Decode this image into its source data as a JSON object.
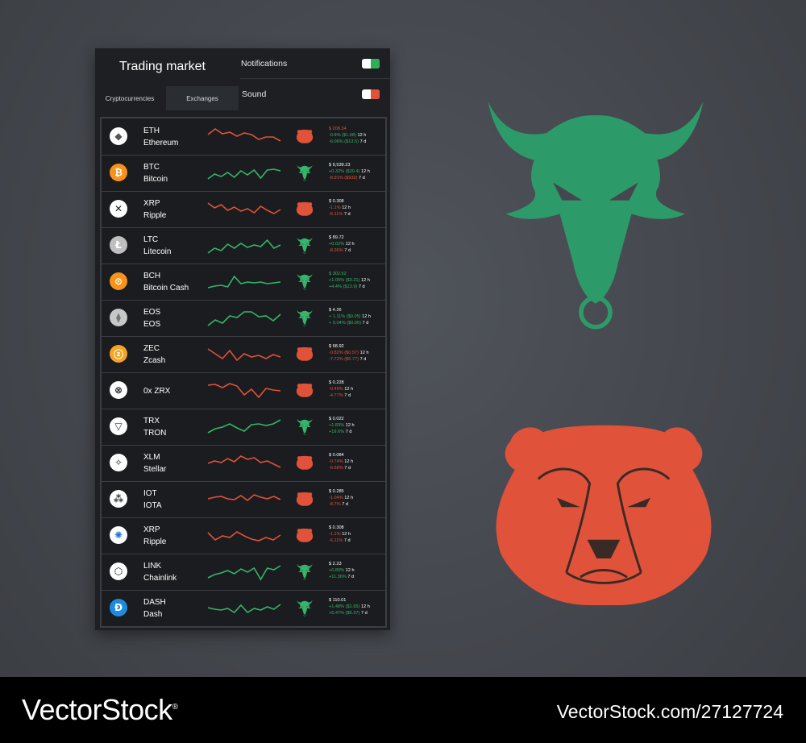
{
  "header": {
    "title": "Trading market"
  },
  "tabs": [
    {
      "label": "Cryptocurrencies"
    },
    {
      "label": "Exchanges"
    }
  ],
  "settings": {
    "notifications": {
      "label": "Notifications",
      "state": "on",
      "color": "#2fae58"
    },
    "sound": {
      "label": "Sound",
      "state": "off",
      "color": "#e0523a"
    }
  },
  "colors": {
    "up": "#35b56a",
    "down": "#e0523a",
    "bull_logo": "#2c9b69",
    "bear_logo": "#e0523a"
  },
  "coins": [
    {
      "symbol": "ETH",
      "name": "Ethereum",
      "icon": "ethereum-icon",
      "glyph": "◆",
      "icon_bg": "#ffffff",
      "icon_fg": "#555555",
      "trend": "down",
      "price": "$ 208.34",
      "price_trend": "down",
      "line1": {
        "text": "-0.8% ($1.68)",
        "period": "12 h",
        "trend": "up"
      },
      "line2": {
        "text": "-6.06% ($13.5)",
        "period": "7 d",
        "trend": "up"
      },
      "spark": [
        10,
        3,
        9,
        7,
        12,
        8,
        10,
        16,
        13,
        13,
        18
      ]
    },
    {
      "symbol": "BTC",
      "name": "Bitcoin",
      "icon": "bitcoin-icon",
      "glyph": "₿",
      "icon_bg": "#f7931a",
      "icon_fg": "#ffffff",
      "trend": "up",
      "price": "$ 9,539.23",
      "price_trend": "neutral",
      "line1": {
        "text": "+0.32% ($30.4)",
        "period": "12 h",
        "trend": "up"
      },
      "line2": {
        "text": "-8.91% ($933)",
        "period": "7 d",
        "trend": "down"
      },
      "spark": [
        20,
        14,
        17,
        12,
        18,
        10,
        15,
        9,
        19,
        9,
        8,
        10
      ]
    },
    {
      "symbol": "XRP",
      "name": "Ripple",
      "icon": "xrp-icon",
      "glyph": "✕",
      "icon_bg": "#ffffff",
      "icon_fg": "#222222",
      "trend": "down",
      "price": "$ 0.308",
      "price_trend": "neutral",
      "line1": {
        "text": "-1.1%",
        "period": "12 h",
        "trend": "down"
      },
      "line2": {
        "text": "-6.11%",
        "period": "7 d",
        "trend": "down"
      },
      "spark": [
        5,
        11,
        7,
        14,
        10,
        15,
        12,
        17,
        9,
        14,
        18,
        13
      ]
    },
    {
      "symbol": "LTC",
      "name": "Litecoin",
      "icon": "litecoin-icon",
      "glyph": "Ł",
      "icon_bg": "#bfbfbf",
      "icon_fg": "#ffffff",
      "trend": "up",
      "price": "$ 89.72",
      "price_trend": "neutral",
      "line1": {
        "text": "+0.02%",
        "period": "12 h",
        "trend": "up"
      },
      "line2": {
        "text": "-8.36%",
        "period": "7 d",
        "trend": "down"
      },
      "spark": [
        22,
        16,
        19,
        11,
        16,
        10,
        15,
        12,
        14,
        6,
        16,
        12
      ]
    },
    {
      "symbol": "BCH",
      "name": "Bitcoin Cash",
      "icon": "bitcoin-cash-icon",
      "glyph": "⊙",
      "icon_bg": "#f7931a",
      "icon_fg": "#ffffff",
      "trend": "up",
      "price": "$ 302.52",
      "price_trend": "up",
      "line1": {
        "text": "+1.05% ($3.21)",
        "period": "12 h",
        "trend": "up"
      },
      "line2": {
        "text": "+4.4% ($13.9)",
        "period": "7 d",
        "trend": "up"
      },
      "spark": [
        20,
        18,
        17,
        19,
        6,
        15,
        13,
        14,
        13,
        15,
        14,
        13
      ]
    },
    {
      "symbol": "EOS",
      "name": "EOS",
      "icon": "eos-icon",
      "glyph": "⧫",
      "icon_bg": "#c8c8c8",
      "icon_fg": "#777777",
      "trend": "up",
      "price": "$ 4.26",
      "price_trend": "neutral",
      "line1": {
        "text": "+ 1.11% ($0.05)",
        "period": "12 h",
        "trend": "up"
      },
      "line2": {
        "text": "+ 0.04% ($0.00)",
        "period": "7 d",
        "trend": "up"
      },
      "spark": [
        22,
        15,
        19,
        10,
        12,
        5,
        5,
        11,
        10,
        16,
        8
      ]
    },
    {
      "symbol": "ZEC",
      "name": "Zcash",
      "icon": "zcash-icon",
      "glyph": "ⓩ",
      "icon_bg": "#f4a623",
      "icon_fg": "#ffffff",
      "trend": "down",
      "price": "$ 68.92",
      "price_trend": "neutral",
      "line1": {
        "text": "-0.82% ($0.57)",
        "period": "12 h",
        "trend": "down"
      },
      "line2": {
        "text": "-7.72% ($5.77)",
        "period": "7 d",
        "trend": "down"
      },
      "spark": [
        6,
        12,
        18,
        8,
        20,
        12,
        16,
        14,
        18,
        13,
        16
      ]
    },
    {
      "symbol": "",
      "name": "0x ZRX",
      "icon": "zrx-icon",
      "glyph": "⊗",
      "icon_bg": "#ffffff",
      "icon_fg": "#222222",
      "trend": "down",
      "price": "$ 0.228",
      "price_trend": "neutral",
      "line1": {
        "text": "-0.49%",
        "period": "12 h",
        "trend": "down"
      },
      "line2": {
        "text": "-4.77%",
        "period": "7 d",
        "trend": "down"
      },
      "spark": [
        6,
        5,
        9,
        4,
        7,
        18,
        11,
        21,
        10,
        12,
        13
      ]
    },
    {
      "symbol": "TRX",
      "name": "TRON",
      "icon": "tron-icon",
      "glyph": "▽",
      "icon_bg": "#ffffff",
      "icon_fg": "#333333",
      "trend": "up",
      "price": "$ 0.022",
      "price_trend": "neutral",
      "line1": {
        "text": "+1.83%",
        "period": "12 h",
        "trend": "up"
      },
      "line2": {
        "text": "+19.6%",
        "period": "7 d",
        "trend": "up"
      },
      "spark": [
        20,
        15,
        13,
        9,
        14,
        18,
        10,
        9,
        11,
        9,
        4
      ]
    },
    {
      "symbol": "XLM",
      "name": "Stellar",
      "icon": "stellar-icon",
      "glyph": "✧",
      "icon_bg": "#ffffff",
      "icon_fg": "#222222",
      "trend": "down",
      "price": "$ 0.084",
      "price_trend": "neutral",
      "line1": {
        "text": "-0.74%",
        "period": "12 h",
        "trend": "down"
      },
      "line2": {
        "text": "-6.68%",
        "period": "7 d",
        "trend": "down"
      },
      "spark": [
        13,
        10,
        12,
        7,
        11,
        4,
        8,
        6,
        12,
        10,
        14,
        18
      ]
    },
    {
      "symbol": "IOT",
      "name": "IOTA",
      "icon": "iota-icon",
      "glyph": "⁂",
      "icon_bg": "#ffffff",
      "icon_fg": "#333333",
      "trend": "down",
      "price": "$ 0.285",
      "price_trend": "neutral",
      "line1": {
        "text": "-1.04%",
        "period": "12 h",
        "trend": "down"
      },
      "line2": {
        "text": "-8.7%",
        "period": "7 d",
        "trend": "down"
      },
      "spark": [
        12,
        10,
        9,
        12,
        13,
        8,
        14,
        7,
        10,
        12,
        9,
        13
      ]
    },
    {
      "symbol": "XRP",
      "name": "Ripple",
      "icon": "ripple-icon",
      "glyph": "✺",
      "icon_bg": "#ffffff",
      "icon_fg": "#1f75d6",
      "trend": "down",
      "price": "$ 0.308",
      "price_trend": "neutral",
      "line1": {
        "text": "-1.1%",
        "period": "12 h",
        "trend": "down"
      },
      "line2": {
        "text": "-6.11%",
        "period": "7 d",
        "trend": "down"
      },
      "spark": [
        9,
        18,
        13,
        15,
        8,
        13,
        17,
        19,
        15,
        18,
        12
      ]
    },
    {
      "symbol": "LINK",
      "name": "Chainlink",
      "icon": "chainlink-icon",
      "glyph": "⬡",
      "icon_bg": "#ffffff",
      "icon_fg": "#222222",
      "trend": "up",
      "price": "$ 2.23",
      "price_trend": "neutral",
      "line1": {
        "text": "+0.89%",
        "period": "12 h",
        "trend": "up"
      },
      "line2": {
        "text": "+11.36%",
        "period": "7 d",
        "trend": "up"
      },
      "spark": [
        20,
        16,
        14,
        11,
        15,
        9,
        13,
        8,
        22,
        8,
        10,
        5
      ]
    },
    {
      "symbol": "DASH",
      "name": "Dash",
      "icon": "dash-icon",
      "glyph": "Đ",
      "icon_bg": "#1c8ce3",
      "icon_fg": "#ffffff",
      "trend": "up",
      "price": "$ 110.01",
      "price_trend": "neutral",
      "line1": {
        "text": "+1.48% ($1.65)",
        "period": "12 h",
        "trend": "up"
      },
      "line2": {
        "text": "+5.47% ($6.37)",
        "period": "7 d",
        "trend": "up"
      },
      "spark": [
        12,
        14,
        15,
        13,
        18,
        9,
        18,
        13,
        15,
        11,
        14,
        8
      ]
    }
  ],
  "watermark": {
    "brand": "VectorStock",
    "registered": "®",
    "url_id": "VectorStock.com/27127724"
  }
}
